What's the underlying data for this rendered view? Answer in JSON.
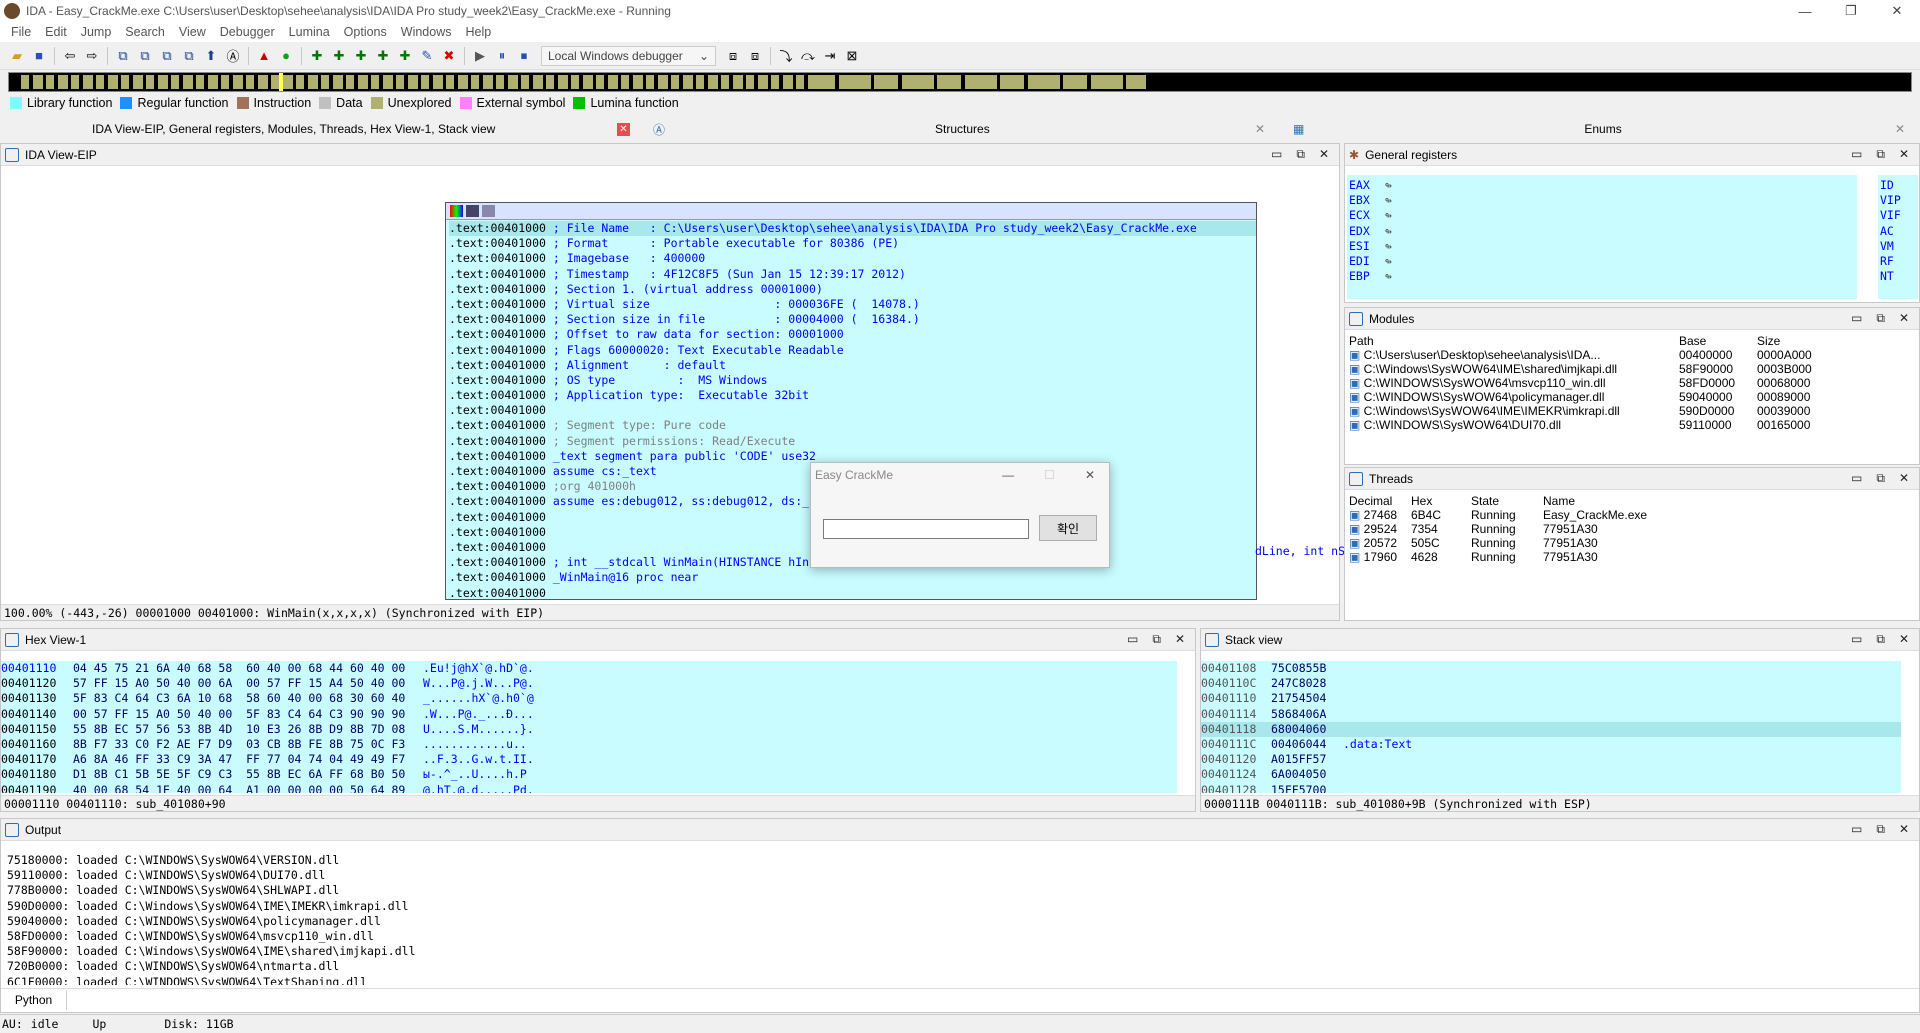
{
  "window": {
    "title": "IDA - Easy_CrackMe.exe C:\\Users\\user\\Desktop\\sehee\\analysis\\IDA\\IDA Pro study_week2\\Easy_CrackMe.exe - Running",
    "min": "—",
    "max": "❐",
    "close": "✕"
  },
  "menu": [
    "File",
    "Edit",
    "Jump",
    "Search",
    "View",
    "Debugger",
    "Lumina",
    "Options",
    "Windows",
    "Help"
  ],
  "toolbar": {
    "debugger": "Local Windows debugger"
  },
  "legend": [
    {
      "label": "Library function",
      "color": "#7ffbff"
    },
    {
      "label": "Regular function",
      "color": "#1e90ff"
    },
    {
      "label": "Instruction",
      "color": "#a0745a"
    },
    {
      "label": "Data",
      "color": "#c0c0c0"
    },
    {
      "label": "Unexplored",
      "color": "#b0b070"
    },
    {
      "label": "External symbol",
      "color": "#ff80ff"
    },
    {
      "label": "Lumina function",
      "color": "#00c000"
    }
  ],
  "tabs": {
    "main": "IDA View-EIP, General registers, Modules, Threads, Hex View-1, Stack view",
    "structures": "Structures",
    "enums": "Enums"
  },
  "idaview": {
    "title": "IDA View-EIP",
    "lines": [
      {
        "addr": ".text:00401000",
        "text": "; File Name   : C:\\Users\\user\\Desktop\\sehee\\analysis\\IDA\\IDA Pro study_week2\\Easy_CrackMe.exe",
        "cls": "blue"
      },
      {
        "addr": ".text:00401000",
        "text": "; Format      : Portable executable for 80386 (PE)",
        "cls": "blue"
      },
      {
        "addr": ".text:00401000",
        "text": "; Imagebase   : 400000",
        "cls": "blue"
      },
      {
        "addr": ".text:00401000",
        "text": "; Timestamp   : 4F12C8F5 (Sun Jan 15 12:39:17 2012)",
        "cls": "blue"
      },
      {
        "addr": ".text:00401000",
        "text": "; Section 1. (virtual address 00001000)",
        "cls": "blue"
      },
      {
        "addr": ".text:00401000",
        "text": "; Virtual size                  : 000036FE (  14078.)",
        "cls": "blue"
      },
      {
        "addr": ".text:00401000",
        "text": "; Section size in file          : 00004000 (  16384.)",
        "cls": "blue"
      },
      {
        "addr": ".text:00401000",
        "text": "; Offset to raw data for section: 00001000",
        "cls": "blue"
      },
      {
        "addr": ".text:00401000",
        "text": "; Flags 60000020: Text Executable Readable",
        "cls": "blue"
      },
      {
        "addr": ".text:00401000",
        "text": "; Alignment     : default",
        "cls": "blue"
      },
      {
        "addr": ".text:00401000",
        "text": "; OS type         :  MS Windows",
        "cls": "blue"
      },
      {
        "addr": ".text:00401000",
        "text": "; Application type:  Executable 32bit",
        "cls": "blue"
      },
      {
        "addr": ".text:00401000",
        "text": "",
        "cls": ""
      },
      {
        "addr": ".text:00401000",
        "text": "; Segment type: Pure code",
        "cls": "grey"
      },
      {
        "addr": ".text:00401000",
        "text": "; Segment permissions: Read/Execute",
        "cls": "grey"
      },
      {
        "addr": ".text:00401000",
        "text": "_text segment para public 'CODE' use32",
        "cls": "blue"
      },
      {
        "addr": ".text:00401000",
        "text": "assume cs:_text",
        "cls": "blue"
      },
      {
        "addr": ".text:00401000",
        "text": ";org 401000h",
        "cls": "grey"
      },
      {
        "addr": ".text:00401000",
        "text": "assume es:debug012, ss:debug012, ds:_",
        "cls": "blue"
      },
      {
        "addr": ".text:00401000",
        "text": "",
        "cls": ""
      },
      {
        "addr": ".text:00401000",
        "text": "",
        "cls": ""
      },
      {
        "addr": ".text:00401000",
        "text": "",
        "cls": ""
      },
      {
        "addr": ".text:00401000",
        "text": "; int __stdcall WinMain(HINSTANCE hIn",
        "cls": "blue"
      },
      {
        "addr": ".text:00401000",
        "text": "_WinMain@16 proc near",
        "cls": "blue"
      },
      {
        "addr": ".text:00401000",
        "text": "",
        "cls": ""
      }
    ],
    "tail": "dLine, int nShowCmd)",
    "status": "100.00% (-443,-26)  00001000 00401000: WinMain(x,x,x,x) (Synchronized with EIP)"
  },
  "dialog": {
    "title": "Easy CrackMe",
    "button": "확인",
    "input": ""
  },
  "registers": {
    "title": "General registers",
    "names": [
      "EAX",
      "EBX",
      "ECX",
      "EDX",
      "ESI",
      "EDI",
      "EBP"
    ],
    "flags": [
      "ID",
      "VIP",
      "VIF",
      "AC",
      "VM",
      "RF",
      "NT"
    ]
  },
  "modules": {
    "title": "Modules",
    "headers": [
      "Path",
      "Base",
      "Size"
    ],
    "rows": [
      [
        "C:\\Users\\user\\Desktop\\sehee\\analysis\\IDA...",
        "00400000",
        "0000A000"
      ],
      [
        "C:\\Windows\\SysWOW64\\IME\\shared\\imjkapi.dll",
        "58F90000",
        "0003B000"
      ],
      [
        "C:\\WINDOWS\\SysWOW64\\msvcp110_win.dll",
        "58FD0000",
        "00068000"
      ],
      [
        "C:\\WINDOWS\\SysWOW64\\policymanager.dll",
        "59040000",
        "00089000"
      ],
      [
        "C:\\Windows\\SysWOW64\\IME\\IMEKR\\imkrapi.dll",
        "590D0000",
        "00039000"
      ],
      [
        "C:\\WINDOWS\\SysWOW64\\DUI70.dll",
        "59110000",
        "00165000"
      ]
    ]
  },
  "threads": {
    "title": "Threads",
    "headers": [
      "Decimal",
      "Hex",
      "State",
      "Name"
    ],
    "rows": [
      [
        "27468",
        "6B4C",
        "Running",
        "Easy_CrackMe.exe"
      ],
      [
        "29524",
        "7354",
        "Running",
        "77951A30"
      ],
      [
        "20572",
        "505C",
        "Running",
        "77951A30"
      ],
      [
        "17960",
        "4628",
        "Running",
        "77951A30"
      ]
    ]
  },
  "hexview": {
    "title": "Hex View-1",
    "rows": [
      {
        "addr": "00401110",
        "hex": "04 45 75 21 6A 40 68 58  60 40 00 68 44 60 40 00",
        "ascii": ".Eu!j@hX`@.hD`@."
      },
      {
        "addr": "00401120",
        "hex": "57 FF 15 A0 50 40 00 6A  00 57 FF 15 A4 50 40 00",
        "ascii": "W...P@.j.W...P@."
      },
      {
        "addr": "00401130",
        "hex": "5F 83 C4 64 C3 6A 10 68  58 60 40 00 68 30 60 40",
        "ascii": "_......hX`@.h0`@"
      },
      {
        "addr": "00401140",
        "hex": "00 57 FF 15 A0 50 40 00  5F 83 C4 64 C3 90 90 90",
        "ascii": ".W...P@._...Ð..."
      },
      {
        "addr": "00401150",
        "hex": "55 8B EC 57 56 53 8B 4D  10 E3 26 8B D9 8B 7D 08",
        "ascii": "U....S.M......}."
      },
      {
        "addr": "00401160",
        "hex": "8B F7 33 C0 F2 AE F7 D9  03 CB 8B FE 8B 75 0C F3",
        "ascii": "............u.."
      },
      {
        "addr": "00401170",
        "hex": "A6 8A 46 FF 33 C9 3A 47  FF 77 04 74 04 49 49 F7",
        "ascii": "..F.3..G.w.t.II."
      },
      {
        "addr": "00401180",
        "hex": "D1 8B C1 5B 5E 5F C9 C3  55 8B EC 6A FF 68 B0 50",
        "ascii": "ы-.^_..U....h.P"
      },
      {
        "addr": "00401190",
        "hex": "40 00 68 54 1E 40 00 64  A1 00 00 00 00 50 64 89",
        "ascii": "@.hT.@.d.....Pd."
      }
    ],
    "status": "00001110 00401110: sub_401080+90"
  },
  "stack": {
    "title": "Stack view",
    "rows": [
      {
        "addr": "00401108",
        "val": "75C0855B",
        "note": ""
      },
      {
        "addr": "0040110C",
        "val": "247C8028",
        "note": ""
      },
      {
        "addr": "00401110",
        "val": "21754504",
        "note": ""
      },
      {
        "addr": "00401114",
        "val": "5868406A",
        "note": ""
      },
      {
        "addr": "00401118",
        "val": "68004060",
        "note": ""
      },
      {
        "addr": "0040111C",
        "val": "00406044",
        "note": ".data:Text"
      },
      {
        "addr": "00401120",
        "val": "A015FF57",
        "note": ""
      },
      {
        "addr": "00401124",
        "val": "6A004050",
        "note": ""
      },
      {
        "addr": "00401128",
        "val": "15FF5700",
        "note": ""
      }
    ],
    "status": "0000111B 0040111B: sub_401080+9B (Synchronized with ESP)"
  },
  "output": {
    "title": "Output",
    "lines": [
      "75180000: loaded C:\\WINDOWS\\SysWOW64\\VERSION.dll",
      "59110000: loaded C:\\WINDOWS\\SysWOW64\\DUI70.dll",
      "778B0000: loaded C:\\WINDOWS\\SysWOW64\\SHLWAPI.dll",
      "590D0000: loaded C:\\Windows\\SysWOW64\\IME\\IMEKR\\imkrapi.dll",
      "59040000: loaded C:\\WINDOWS\\SysWOW64\\policymanager.dll",
      "58FD0000: loaded C:\\WINDOWS\\SysWOW64\\msvcp110_win.dll",
      "58F90000: loaded C:\\Windows\\SysWOW64\\IME\\shared\\imjkapi.dll",
      "720B0000: loaded C:\\WINDOWS\\SysWOW64\\ntmarta.dll",
      "6C1F0000: loaded C:\\WINDOWS\\SysWOW64\\TextShaping.dll"
    ],
    "lang": "Python"
  },
  "statusbar": {
    "au": "AU:",
    "state": "idle",
    "dir": "Up",
    "disk": "Disk: 11GB"
  }
}
